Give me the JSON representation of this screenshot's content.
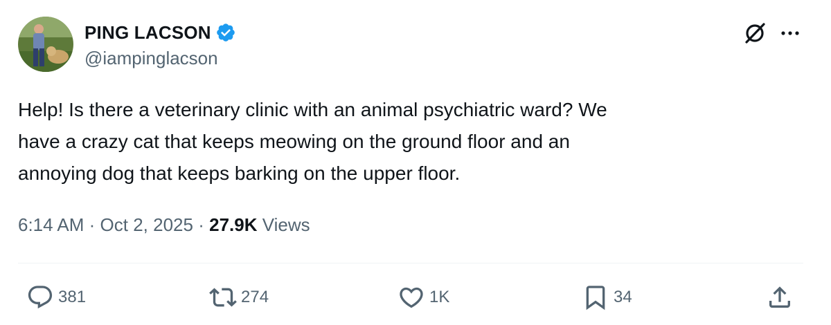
{
  "author": {
    "display_name": "PING LACSON",
    "handle": "@iampinglacson",
    "verified": true,
    "verified_color": "#1d9bf0"
  },
  "tweet": {
    "text_lines": [
      "Help! Is there a veterinary clinic with an animal psychiatric ward? We",
      "have a crazy cat that keeps meowing on the ground floor and an",
      "annoying dog that keeps barking on the upper floor."
    ],
    "time": "6:14 AM",
    "separator": "·",
    "date": "Oct 2, 2025",
    "views_count": "27.9K",
    "views_label": "Views"
  },
  "header_actions": {
    "grok_icon": "grok-icon",
    "more_icon": "more-icon"
  },
  "actions": {
    "reply": {
      "icon": "reply-icon",
      "count": "381"
    },
    "retweet": {
      "icon": "retweet-icon",
      "count": "274"
    },
    "like": {
      "icon": "heart-icon",
      "count": "1K"
    },
    "bookmark": {
      "icon": "bookmark-icon",
      "count": "34"
    },
    "share": {
      "icon": "share-icon"
    }
  },
  "colors": {
    "text_primary": "#0f1419",
    "text_secondary": "#536471",
    "divider": "#eff3f4",
    "accent": "#1d9bf0"
  }
}
